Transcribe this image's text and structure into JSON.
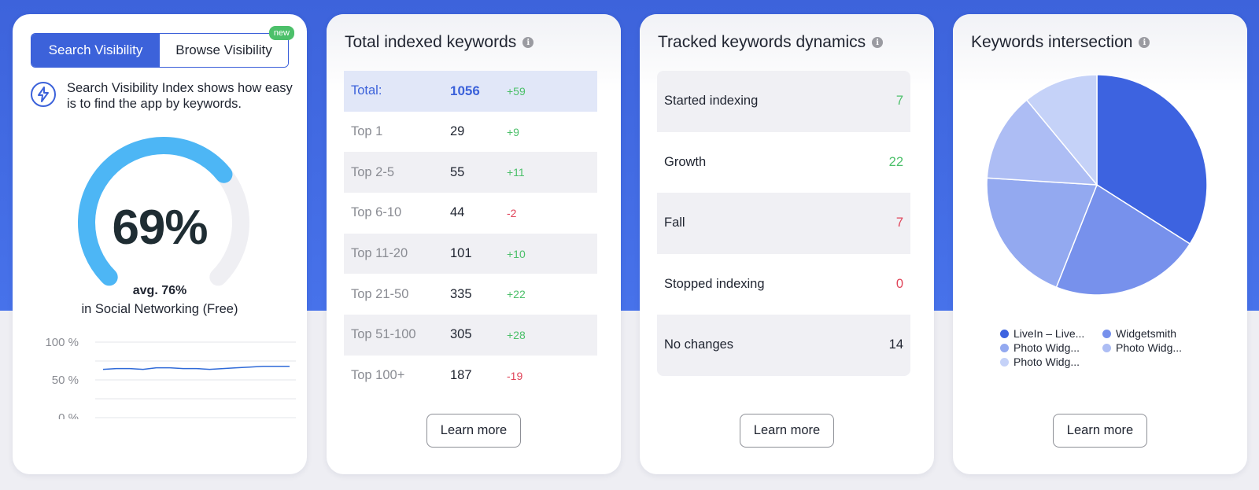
{
  "visibility": {
    "tabs": [
      "Search Visibility",
      "Browse Visibility"
    ],
    "new_badge": "new",
    "info_text": "Search Visibility Index shows how easy is to find the app by keywords.",
    "value": 69,
    "value_label": "69%",
    "avg_label": "avg. 76%",
    "category_label": "in Social Networking (Free)",
    "history": {
      "type": "line",
      "y_ticks": [
        "100 %",
        "50 %",
        "0 %"
      ],
      "ylim": [
        0,
        100
      ],
      "values": [
        64,
        65,
        65,
        64,
        66,
        66,
        65,
        65,
        64,
        65,
        66,
        67,
        68,
        68,
        68
      ]
    },
    "colors": {
      "accent": "#3c62da",
      "gauge": "#4db6f5",
      "gauge_track": "#efeff3"
    }
  },
  "indexed": {
    "title": "Total indexed keywords",
    "rows": [
      {
        "label": "Total:",
        "value": "1056",
        "delta": "+59",
        "dir": "pos"
      },
      {
        "label": "Top 1",
        "value": "29",
        "delta": "+9",
        "dir": "pos"
      },
      {
        "label": "Top 2-5",
        "value": "55",
        "delta": "+11",
        "dir": "pos"
      },
      {
        "label": "Top 6-10",
        "value": "44",
        "delta": "-2",
        "dir": "neg"
      },
      {
        "label": "Top 11-20",
        "value": "101",
        "delta": "+10",
        "dir": "pos"
      },
      {
        "label": "Top 21-50",
        "value": "335",
        "delta": "+22",
        "dir": "pos"
      },
      {
        "label": "Top 51-100",
        "value": "305",
        "delta": "+28",
        "dir": "pos"
      },
      {
        "label": "Top 100+",
        "value": "187",
        "delta": "-19",
        "dir": "neg"
      }
    ],
    "button": "Learn more"
  },
  "dynamics": {
    "title": "Tracked keywords dynamics",
    "rows": [
      {
        "label": "Started indexing",
        "value": "7",
        "dir": "pos"
      },
      {
        "label": "Growth",
        "value": "22",
        "dir": "pos"
      },
      {
        "label": "Fall",
        "value": "7",
        "dir": "neg"
      },
      {
        "label": "Stopped indexing",
        "value": "0",
        "dir": "neg"
      },
      {
        "label": "No changes",
        "value": "14",
        "dir": "neutral"
      }
    ],
    "button": "Learn more"
  },
  "intersection": {
    "title": "Keywords intersection",
    "button": "Learn more",
    "chart_data": {
      "type": "pie",
      "values": [
        34,
        22,
        20,
        13,
        11
      ],
      "labels": [
        "LiveIn – Live...",
        "Widgetsmith",
        "Photo Widg...",
        "Photo Widg...",
        "Photo Widg..."
      ],
      "colors": [
        "#3d63e0",
        "#7791ec",
        "#93a9f0",
        "#adbdf4",
        "#c5d2f8"
      ]
    }
  }
}
